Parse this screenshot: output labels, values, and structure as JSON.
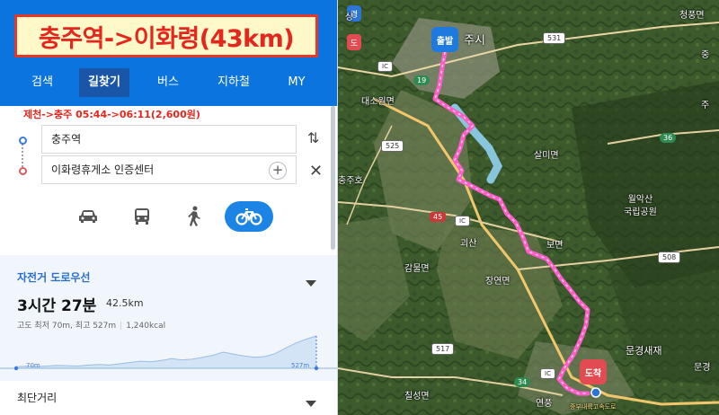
{
  "title": "충주역->이화령(43km)",
  "nav": {
    "tabs": [
      {
        "label": "검색",
        "active": false
      },
      {
        "label": "길찾기",
        "active": true
      },
      {
        "label": "버스",
        "active": false
      },
      {
        "label": "지하철",
        "active": false
      },
      {
        "label": "MY",
        "active": false
      }
    ]
  },
  "bus_note": "제천->충주 05:44->06:11(2,600원)",
  "route": {
    "start": "충주역",
    "end": "이화령휴게소 인증센터",
    "add_symbol": "+",
    "modes": [
      {
        "icon": "car-icon",
        "selected": false
      },
      {
        "icon": "taxi-icon",
        "selected": false
      },
      {
        "icon": "walk-icon",
        "selected": false
      },
      {
        "icon": "bicycle-icon",
        "selected": true
      }
    ]
  },
  "result": {
    "type": "자전거 도로우선",
    "duration": "3시간 27분",
    "distance": "42.5km",
    "elevation_text": "고도 최저 70m, 최고 527m",
    "calories": "1,240kcal",
    "elev_low_label": "70m",
    "elev_high_label": "527m",
    "elevation_profile": [
      0.05,
      0.06,
      0.05,
      0.07,
      0.09,
      0.08,
      0.07,
      0.1,
      0.12,
      0.1,
      0.14,
      0.18,
      0.22,
      0.2,
      0.24,
      0.3,
      0.26,
      0.28,
      0.34,
      0.4,
      0.5,
      0.44,
      0.38,
      0.34,
      0.36,
      0.45,
      0.62,
      0.78,
      0.9,
      1.0
    ]
  },
  "alt_route": "최단거리",
  "map": {
    "labels": {
      "start_marker": "출발",
      "end_marker": "도착",
      "pin_a": "경",
      "pin_b": "도",
      "city": "주시",
      "daesowon": "대소원면",
      "salmi": "살미면",
      "wolaksan": "월악산\n국립공원",
      "goesan": "괴산",
      "jangyeon": "장연면",
      "boomyeon": "보면",
      "gamnyeon": "감물면",
      "mungyeong": "문경새재",
      "chilseong": "칠성면",
      "yeonpung": "연풍",
      "cheongpung": "청풍면",
      "jung": "중",
      "ju": "주",
      "mungyeong2": "문경",
      "lake": "충주호",
      "river_road": "중부내륙고속도로",
      "sang": "상"
    },
    "roads": {
      "r19": "19",
      "r525": "525",
      "r531": "531",
      "r36": "36",
      "r45": "45",
      "r508": "508",
      "r517": "517",
      "r34": "34",
      "ic1": "IC",
      "ic2": "IC",
      "ic3": "IC"
    }
  },
  "colors": {
    "header_blue": "#0b74de",
    "title_red": "#e5261c",
    "route_pink": "#ff5cc8",
    "accent_blue": "#1b84e4"
  }
}
